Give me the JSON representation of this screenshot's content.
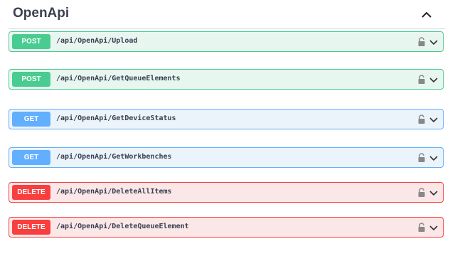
{
  "section": {
    "title": "OpenApi",
    "collapse_icon": "chevron-up-icon"
  },
  "operations": [
    {
      "method": "POST",
      "path": "/api/OpenApi/Upload",
      "color": "#49cc90"
    },
    {
      "method": "POST",
      "path": "/api/OpenApi/GetQueueElements",
      "color": "#49cc90"
    },
    {
      "method": "GET",
      "path": "/api/OpenApi/GetDeviceStatus",
      "color": "#61affe"
    },
    {
      "method": "GET",
      "path": "/api/OpenApi/GetWorkbenches",
      "color": "#61affe"
    },
    {
      "method": "DELETE",
      "path": "/api/OpenApi/DeleteAllItems",
      "color": "#f93e3e"
    },
    {
      "method": "DELETE",
      "path": "/api/OpenApi/DeleteQueueElement",
      "color": "#f93e3e"
    }
  ],
  "icons": {
    "lock": "lock-icon",
    "expand": "chevron-down-icon"
  }
}
